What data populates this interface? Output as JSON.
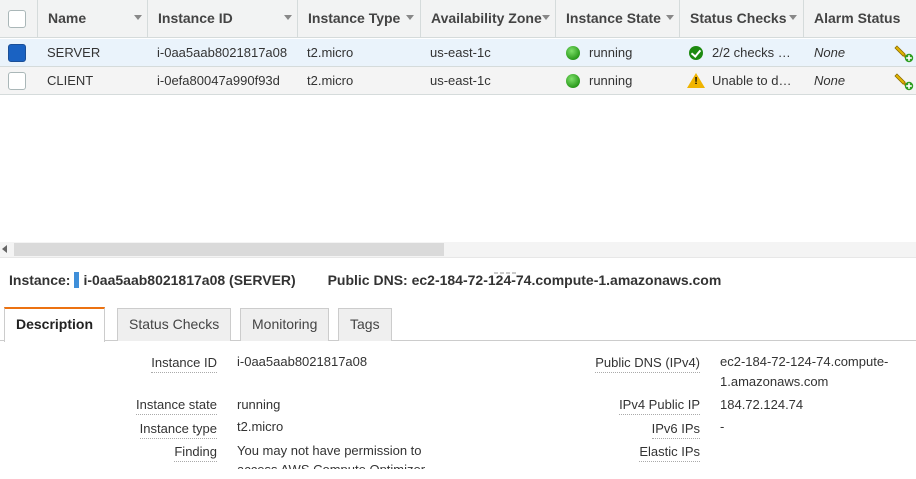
{
  "table": {
    "columns": [
      {
        "key": "name",
        "label": "Name"
      },
      {
        "key": "instance_id",
        "label": "Instance ID"
      },
      {
        "key": "instance_type",
        "label": "Instance Type"
      },
      {
        "key": "availability_zone",
        "label": "Availability Zone"
      },
      {
        "key": "instance_state",
        "label": "Instance State"
      },
      {
        "key": "status_checks",
        "label": "Status Checks"
      },
      {
        "key": "alarm_status",
        "label": "Alarm Status"
      }
    ],
    "rows": [
      {
        "selected": true,
        "name": "SERVER",
        "instance_id": "i-0aa5aab8021817a08",
        "instance_type": "t2.micro",
        "availability_zone": "us-east-1c",
        "instance_state": "running",
        "state_icon": "green-dot-icon",
        "status_checks": "2/2 checks …",
        "status_icon": "green-check-icon",
        "alarm_status": "None",
        "alarm_icon": "add-alarm-icon"
      },
      {
        "selected": false,
        "name": "CLIENT",
        "instance_id": "i-0efa80047a990f93d",
        "instance_type": "t2.micro",
        "availability_zone": "us-east-1c",
        "instance_state": "running",
        "state_icon": "green-dot-icon",
        "status_checks": "Unable to d…",
        "status_icon": "warning-icon",
        "alarm_status": "None",
        "alarm_icon": "add-alarm-icon"
      }
    ]
  },
  "summary": {
    "instance_label": "Instance:",
    "instance_value": "i-0aa5aab8021817a08 (SERVER)",
    "dns_label": "Public DNS:",
    "dns_value": "ec2-184-72-124-74.compute-1.amazonaws.com"
  },
  "tabs": [
    {
      "label": "Description",
      "active": true
    },
    {
      "label": "Status Checks",
      "active": false
    },
    {
      "label": "Monitoring",
      "active": false
    },
    {
      "label": "Tags",
      "active": false
    }
  ],
  "details": {
    "left": [
      {
        "label": "Instance ID",
        "value": "i-0aa5aab8021817a08"
      },
      {
        "label": "Instance state",
        "value": "running"
      },
      {
        "label": "Instance type",
        "value": "t2.micro"
      },
      {
        "label": "Finding",
        "value_line1": "You may not have permission to",
        "value_line2": "access AWS Compute Optimizer"
      }
    ],
    "right": [
      {
        "label": "Public DNS (IPv4)",
        "value_line1": "ec2-184-72-124-74.compute-",
        "value_line2": "1.amazonaws.com"
      },
      {
        "label": "IPv4 Public IP",
        "value": "184.72.124.74"
      },
      {
        "label": "IPv6 IPs",
        "value": "-"
      },
      {
        "label": "Elastic IPs",
        "value": ""
      }
    ]
  },
  "colors": {
    "selected_row": "#eaf3fb",
    "checkbox_selected": "#1a62c2",
    "running_green": "#2a9a1c",
    "warning_yellow": "#f0b400",
    "active_tab_accent": "#ec7211",
    "instance_bar": "#3f8fd9"
  }
}
